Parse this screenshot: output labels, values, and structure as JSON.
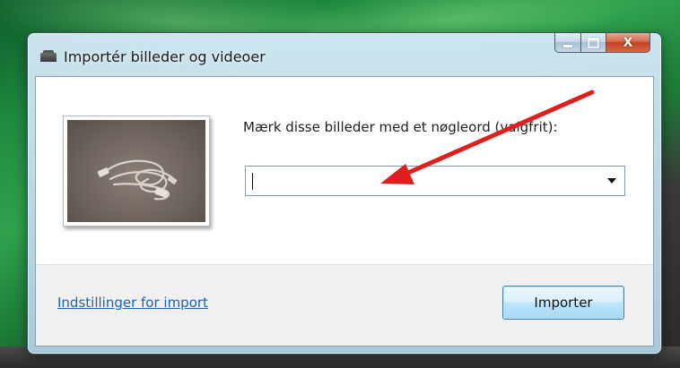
{
  "window": {
    "title": "Importér billeder og videoer",
    "caption_buttons": {
      "minimize_icon": "minimize-icon",
      "maximize_icon": "maximize-icon",
      "close_glyph": "X"
    }
  },
  "main": {
    "prompt_label": "Mærk disse billeder med et nøgleord (valgfrit):",
    "tag_input_value": "",
    "thumbnail_icon": "photo-thumbnail"
  },
  "footer": {
    "settings_link": "Indstillinger for import",
    "import_button": "Importer"
  },
  "colors": {
    "link": "#1c63b3",
    "annotation_arrow": "#e01e1e",
    "close_button": "#c1401f"
  }
}
